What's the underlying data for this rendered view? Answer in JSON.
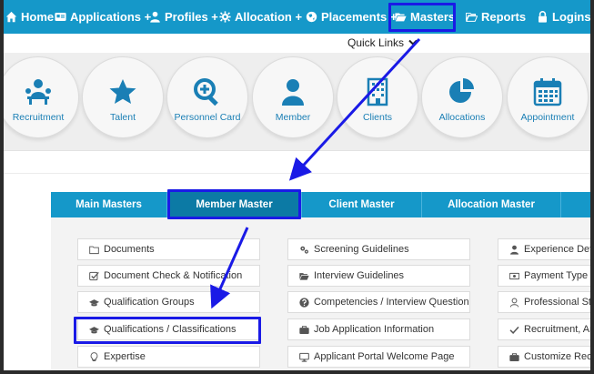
{
  "nav": {
    "home": "Home",
    "applications": "Applications +",
    "profiles": "Profiles +",
    "allocation": "Allocation +",
    "placements": "Placements +",
    "masters": "Masters",
    "reports": "Reports",
    "logins": "Logins +"
  },
  "quick_links": "Quick Links",
  "circles": [
    {
      "label": "Recruitment",
      "icon": "recruitment-icon"
    },
    {
      "label": "Talent",
      "icon": "star-icon"
    },
    {
      "label": "Personnel Card",
      "icon": "magnify-plus-icon"
    },
    {
      "label": "Member",
      "icon": "user-icon"
    },
    {
      "label": "Clients",
      "icon": "building-icon"
    },
    {
      "label": "Allocations",
      "icon": "pie-chart-icon"
    },
    {
      "label": "Appointment",
      "icon": "calendar-icon"
    }
  ],
  "tabs": [
    "Main Masters",
    "Member Master",
    "Client Master",
    "Allocation Master"
  ],
  "col1": [
    "Documents",
    "Document Check & Notification",
    "Qualification Groups",
    "Qualifications / Classifications",
    "Expertise"
  ],
  "col2": [
    "Screening Guidelines",
    "Interview Guidelines",
    "Competencies / Interview Questions",
    "Job Application Information",
    "Applicant Portal Welcome Page"
  ],
  "col3": [
    "Experience Deta",
    "Payment Type",
    "Professional Stat",
    "Recruitment, Ar",
    "Customize Recr"
  ],
  "colors": {
    "nav_bg": "#1598c9",
    "active_tab": "#0c7aa5",
    "annotation": "#1a1ae6",
    "circle_icon": "#1a7fb5"
  }
}
